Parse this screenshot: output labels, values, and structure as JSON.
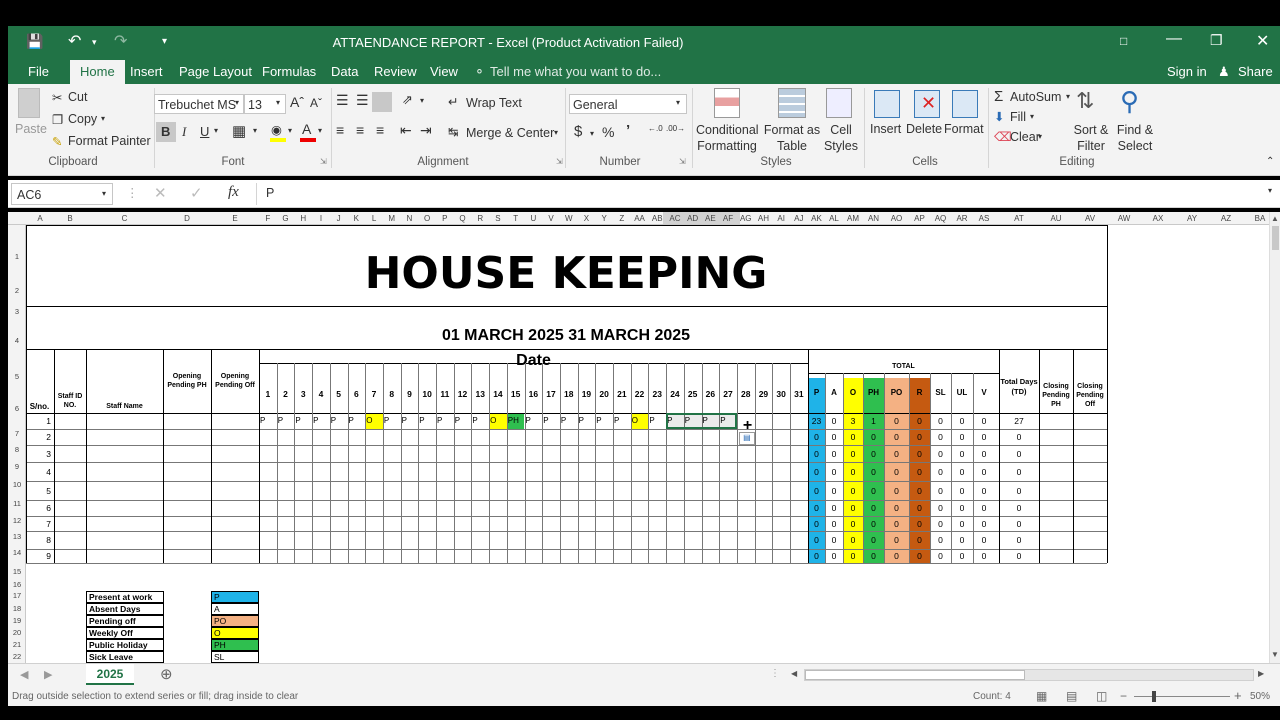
{
  "window": {
    "title": "ATTAENDANCE REPORT - Excel (Product Activation Failed)"
  },
  "menu": {
    "file": "File",
    "tabs": [
      "Home",
      "Insert",
      "Page Layout",
      "Formulas",
      "Data",
      "Review",
      "View"
    ],
    "tell": "Tell me what you want to do...",
    "signin": "Sign in",
    "share": "Share"
  },
  "ribbon": {
    "clipboard": {
      "paste": "Paste",
      "cut": "Cut",
      "copy": "Copy",
      "painter": "Format Painter",
      "label": "Clipboard"
    },
    "font": {
      "name": "Trebuchet MS",
      "size": "13",
      "label": "Font",
      "bold": "B",
      "italic": "I",
      "underline": "U"
    },
    "alignment": {
      "wrap": "Wrap Text",
      "merge": "Merge & Center",
      "label": "Alignment"
    },
    "number": {
      "format": "General",
      "label": "Number",
      "currency": "$",
      "percent": "%",
      "comma": "’"
    },
    "styles": {
      "cond": "Conditional Formatting",
      "table": "Format as Table",
      "cell": "Cell Styles",
      "label": "Styles"
    },
    "cells": {
      "insert": "Insert",
      "delete": "Delete",
      "format": "Format",
      "label": "Cells"
    },
    "editing": {
      "autosum": "AutoSum",
      "fill": "Fill",
      "clear": "Clear",
      "sort": "Sort & Filter",
      "find": "Find & Select",
      "label": "Editing"
    }
  },
  "formula": {
    "namebox": "AC6",
    "fx": "fx",
    "value": "P"
  },
  "sheet": {
    "title": "HOUSE KEEPING",
    "period": "01 MARCH  2025 31 MARCH  2025",
    "date_label": "Date",
    "total_label": "TOTAL",
    "headers": {
      "sno": "S/no.",
      "staffid": "Staff ID NO.",
      "name": "Staff Name",
      "oph": "Opening Pending PH",
      "ooff": "Opening Pending Off",
      "td": "Total Days (TD)",
      "cph": "Closing Pending PH",
      "coff": "Closing Pending Off"
    },
    "days": [
      "1",
      "2",
      "3",
      "4",
      "5",
      "6",
      "7",
      "8",
      "9",
      "10",
      "11",
      "12",
      "13",
      "14",
      "15",
      "16",
      "17",
      "18",
      "19",
      "20",
      "21",
      "22",
      "23",
      "24",
      "25",
      "26",
      "27",
      "28",
      "29",
      "30",
      "31"
    ],
    "total_cols": [
      "P",
      "A",
      "O",
      "PH",
      "PO",
      "R",
      "SL",
      "UL",
      "V"
    ],
    "row1_marks": [
      "P",
      "P",
      "P",
      "P",
      "P",
      "P",
      "O",
      "P",
      "P",
      "P",
      "P",
      "P",
      "P",
      "O",
      "PH",
      "P",
      "P",
      "P",
      "P",
      "P",
      "P",
      "O",
      "P",
      "P",
      "P",
      "P",
      "P",
      "",
      "",
      "",
      ""
    ],
    "rows": [
      {
        "sno": "1",
        "totals": [
          "23",
          "0",
          "3",
          "1",
          "0",
          "0",
          "0",
          "0",
          "0"
        ],
        "td": "27"
      },
      {
        "sno": "2",
        "totals": [
          "0",
          "0",
          "0",
          "0",
          "0",
          "0",
          "0",
          "0",
          "0"
        ],
        "td": "0"
      },
      {
        "sno": "3",
        "totals": [
          "0",
          "0",
          "0",
          "0",
          "0",
          "0",
          "0",
          "0",
          "0"
        ],
        "td": "0"
      },
      {
        "sno": "4",
        "totals": [
          "0",
          "0",
          "0",
          "0",
          "0",
          "0",
          "0",
          "0",
          "0"
        ],
        "td": "0"
      },
      {
        "sno": "5",
        "totals": [
          "0",
          "0",
          "0",
          "0",
          "0",
          "0",
          "0",
          "0",
          "0"
        ],
        "td": "0"
      },
      {
        "sno": "6",
        "totals": [
          "0",
          "0",
          "0",
          "0",
          "0",
          "0",
          "0",
          "0",
          "0"
        ],
        "td": "0"
      },
      {
        "sno": "7",
        "totals": [
          "0",
          "0",
          "0",
          "0",
          "0",
          "0",
          "0",
          "0",
          "0"
        ],
        "td": "0"
      },
      {
        "sno": "8",
        "totals": [
          "0",
          "0",
          "0",
          "0",
          "0",
          "0",
          "0",
          "0",
          "0"
        ],
        "td": "0"
      },
      {
        "sno": "9",
        "totals": [
          "0",
          "0",
          "0",
          "0",
          "0",
          "0",
          "0",
          "0",
          "0"
        ],
        "td": "0"
      }
    ],
    "legend": [
      {
        "label": "Present at work",
        "code": "P",
        "color": "#1fb3e8"
      },
      {
        "label": "Absent Days",
        "code": "A",
        "color": "#ffffff"
      },
      {
        "label": "Pending off",
        "code": "PO",
        "color": "#f4b183"
      },
      {
        "label": "Weekly Off",
        "code": "O",
        "color": "#ffff00"
      },
      {
        "label": "Public Holiday",
        "code": "PH",
        "color": "#2fbf4f"
      },
      {
        "label": "Sick Leave",
        "code": "SL",
        "color": "#ffffff"
      }
    ],
    "col_letters": [
      "A",
      "B",
      "C",
      "D",
      "E",
      "F",
      "G",
      "H",
      "I",
      "J",
      "K",
      "L",
      "M",
      "N",
      "O",
      "P",
      "Q",
      "R",
      "S",
      "T",
      "U",
      "V",
      "W",
      "X",
      "Y",
      "Z",
      "AA",
      "AB",
      "AC",
      "AD",
      "AE",
      "AF",
      "AG",
      "AH",
      "AI",
      "AJ",
      "AK",
      "AL",
      "AM",
      "AN",
      "AO",
      "AP",
      "AQ",
      "AR",
      "AS",
      "AT",
      "AU",
      "AV",
      "AW",
      "AX",
      "AY",
      "AZ",
      "BA"
    ],
    "row_numbers": [
      "1",
      "2",
      "3",
      "4",
      "5",
      "6",
      "7",
      "8",
      "9",
      "10",
      "11",
      "12",
      "13",
      "14",
      "15",
      "16",
      "17",
      "18",
      "19",
      "20",
      "21",
      "22"
    ]
  },
  "colors": {
    "P": "#1fb3e8",
    "O": "#ffff00",
    "PH": "#2fbf4f",
    "PO": "#f4b183",
    "R": "#c55a11",
    "excel": "#217346"
  },
  "sheet_tab": "2025",
  "status": {
    "message": "Drag outside selection to extend series or fill; drag inside to clear",
    "count": "Count: 4",
    "zoom": "50%"
  }
}
